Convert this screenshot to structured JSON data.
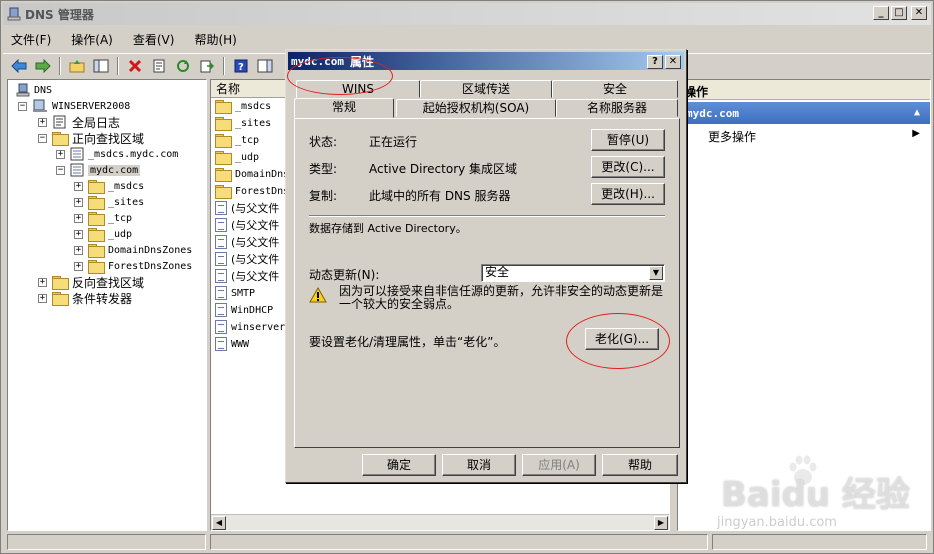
{
  "window": {
    "title": "DNS 管理器",
    "controls": [
      "_",
      "□",
      "✕"
    ]
  },
  "menu": [
    "文件(F)",
    "操作(A)",
    "查看(V)",
    "帮助(H)"
  ],
  "tree": {
    "root": "DNS",
    "server": "WINSERVER2008",
    "global_log": "全局日志",
    "forward_zones": "正向查找区域",
    "msdcs_zone": "_msdcs.mydc.com",
    "selected_zone": "mydc.com",
    "sub_msdcs": "_msdcs",
    "sub_sites": "_sites",
    "sub_tcp": "_tcp",
    "sub_udp": "_udp",
    "sub_domaindns": "DomainDnsZones",
    "sub_forestdns": "ForestDnsZones",
    "reverse_zones": "反向查找区域",
    "conditional_forwarders": "条件转发器"
  },
  "list": {
    "header_name": "名称",
    "rows": [
      "_msdcs",
      "_sites",
      "_tcp",
      "_udp",
      "DomainDns",
      "ForestDns",
      "(与父文件",
      "(与父文件",
      "(与父文件",
      "(与父文件",
      "(与父文件",
      "SMTP",
      "WinDHCP",
      "winserver",
      "WWW"
    ]
  },
  "actions": {
    "title": "操作",
    "section": "mydc.com",
    "more": "更多操作"
  },
  "dialog": {
    "title_zone": "mydc.com",
    "title_suffix": "属性",
    "tabs_back": [
      "WINS",
      "区域传送",
      "安全"
    ],
    "tabs_front": [
      "常规",
      "起始授权机构(SOA)",
      "名称服务器"
    ],
    "status_label": "状态:",
    "status_value": "正在运行",
    "pause_button": "暂停(U)",
    "type_label": "类型:",
    "type_value": "Active Directory 集成区域",
    "type_change_button": "更改(C)...",
    "replication_label": "复制:",
    "replication_value": "此域中的所有 DNS 服务器",
    "replication_change_button": "更改(H)...",
    "storage_note": "数据存储到 Active Directory。",
    "dynamic_update_label": "动态更新(N):",
    "dynamic_update_value": "安全",
    "warning_text": "因为可以接受来自非信任源的更新，允许非安全的动态更新是一个较大的安全弱点。",
    "aging_note": "要设置老化/清理属性，单击“老化”。",
    "aging_button": "老化(G)...",
    "ok_button": "确定",
    "cancel_button": "取消",
    "apply_button": "应用(A)",
    "help_button": "帮助"
  },
  "watermark": {
    "brand": "Baidu 经验",
    "url": "jingyan.baidu.com"
  },
  "colors": {
    "accent_title": "#0a246a",
    "action_section": "#3e6fbf",
    "annotation": "#e02020"
  }
}
